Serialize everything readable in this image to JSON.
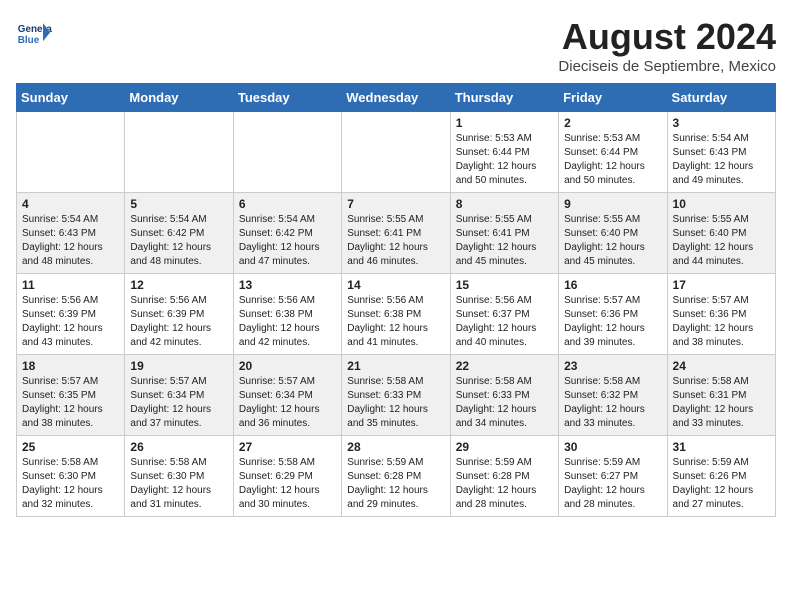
{
  "logo": {
    "line1": "General",
    "line2": "Blue"
  },
  "title": "August 2024",
  "subtitle": "Dieciseis de Septiembre, Mexico",
  "weekdays": [
    "Sunday",
    "Monday",
    "Tuesday",
    "Wednesday",
    "Thursday",
    "Friday",
    "Saturday"
  ],
  "weeks": [
    [
      {
        "day": "",
        "info": ""
      },
      {
        "day": "",
        "info": ""
      },
      {
        "day": "",
        "info": ""
      },
      {
        "day": "",
        "info": ""
      },
      {
        "day": "1",
        "info": "Sunrise: 5:53 AM\nSunset: 6:44 PM\nDaylight: 12 hours\nand 50 minutes."
      },
      {
        "day": "2",
        "info": "Sunrise: 5:53 AM\nSunset: 6:44 PM\nDaylight: 12 hours\nand 50 minutes."
      },
      {
        "day": "3",
        "info": "Sunrise: 5:54 AM\nSunset: 6:43 PM\nDaylight: 12 hours\nand 49 minutes."
      }
    ],
    [
      {
        "day": "4",
        "info": "Sunrise: 5:54 AM\nSunset: 6:43 PM\nDaylight: 12 hours\nand 48 minutes."
      },
      {
        "day": "5",
        "info": "Sunrise: 5:54 AM\nSunset: 6:42 PM\nDaylight: 12 hours\nand 48 minutes."
      },
      {
        "day": "6",
        "info": "Sunrise: 5:54 AM\nSunset: 6:42 PM\nDaylight: 12 hours\nand 47 minutes."
      },
      {
        "day": "7",
        "info": "Sunrise: 5:55 AM\nSunset: 6:41 PM\nDaylight: 12 hours\nand 46 minutes."
      },
      {
        "day": "8",
        "info": "Sunrise: 5:55 AM\nSunset: 6:41 PM\nDaylight: 12 hours\nand 45 minutes."
      },
      {
        "day": "9",
        "info": "Sunrise: 5:55 AM\nSunset: 6:40 PM\nDaylight: 12 hours\nand 45 minutes."
      },
      {
        "day": "10",
        "info": "Sunrise: 5:55 AM\nSunset: 6:40 PM\nDaylight: 12 hours\nand 44 minutes."
      }
    ],
    [
      {
        "day": "11",
        "info": "Sunrise: 5:56 AM\nSunset: 6:39 PM\nDaylight: 12 hours\nand 43 minutes."
      },
      {
        "day": "12",
        "info": "Sunrise: 5:56 AM\nSunset: 6:39 PM\nDaylight: 12 hours\nand 42 minutes."
      },
      {
        "day": "13",
        "info": "Sunrise: 5:56 AM\nSunset: 6:38 PM\nDaylight: 12 hours\nand 42 minutes."
      },
      {
        "day": "14",
        "info": "Sunrise: 5:56 AM\nSunset: 6:38 PM\nDaylight: 12 hours\nand 41 minutes."
      },
      {
        "day": "15",
        "info": "Sunrise: 5:56 AM\nSunset: 6:37 PM\nDaylight: 12 hours\nand 40 minutes."
      },
      {
        "day": "16",
        "info": "Sunrise: 5:57 AM\nSunset: 6:36 PM\nDaylight: 12 hours\nand 39 minutes."
      },
      {
        "day": "17",
        "info": "Sunrise: 5:57 AM\nSunset: 6:36 PM\nDaylight: 12 hours\nand 38 minutes."
      }
    ],
    [
      {
        "day": "18",
        "info": "Sunrise: 5:57 AM\nSunset: 6:35 PM\nDaylight: 12 hours\nand 38 minutes."
      },
      {
        "day": "19",
        "info": "Sunrise: 5:57 AM\nSunset: 6:34 PM\nDaylight: 12 hours\nand 37 minutes."
      },
      {
        "day": "20",
        "info": "Sunrise: 5:57 AM\nSunset: 6:34 PM\nDaylight: 12 hours\nand 36 minutes."
      },
      {
        "day": "21",
        "info": "Sunrise: 5:58 AM\nSunset: 6:33 PM\nDaylight: 12 hours\nand 35 minutes."
      },
      {
        "day": "22",
        "info": "Sunrise: 5:58 AM\nSunset: 6:33 PM\nDaylight: 12 hours\nand 34 minutes."
      },
      {
        "day": "23",
        "info": "Sunrise: 5:58 AM\nSunset: 6:32 PM\nDaylight: 12 hours\nand 33 minutes."
      },
      {
        "day": "24",
        "info": "Sunrise: 5:58 AM\nSunset: 6:31 PM\nDaylight: 12 hours\nand 33 minutes."
      }
    ],
    [
      {
        "day": "25",
        "info": "Sunrise: 5:58 AM\nSunset: 6:30 PM\nDaylight: 12 hours\nand 32 minutes."
      },
      {
        "day": "26",
        "info": "Sunrise: 5:58 AM\nSunset: 6:30 PM\nDaylight: 12 hours\nand 31 minutes."
      },
      {
        "day": "27",
        "info": "Sunrise: 5:58 AM\nSunset: 6:29 PM\nDaylight: 12 hours\nand 30 minutes."
      },
      {
        "day": "28",
        "info": "Sunrise: 5:59 AM\nSunset: 6:28 PM\nDaylight: 12 hours\nand 29 minutes."
      },
      {
        "day": "29",
        "info": "Sunrise: 5:59 AM\nSunset: 6:28 PM\nDaylight: 12 hours\nand 28 minutes."
      },
      {
        "day": "30",
        "info": "Sunrise: 5:59 AM\nSunset: 6:27 PM\nDaylight: 12 hours\nand 28 minutes."
      },
      {
        "day": "31",
        "info": "Sunrise: 5:59 AM\nSunset: 6:26 PM\nDaylight: 12 hours\nand 27 minutes."
      }
    ]
  ]
}
